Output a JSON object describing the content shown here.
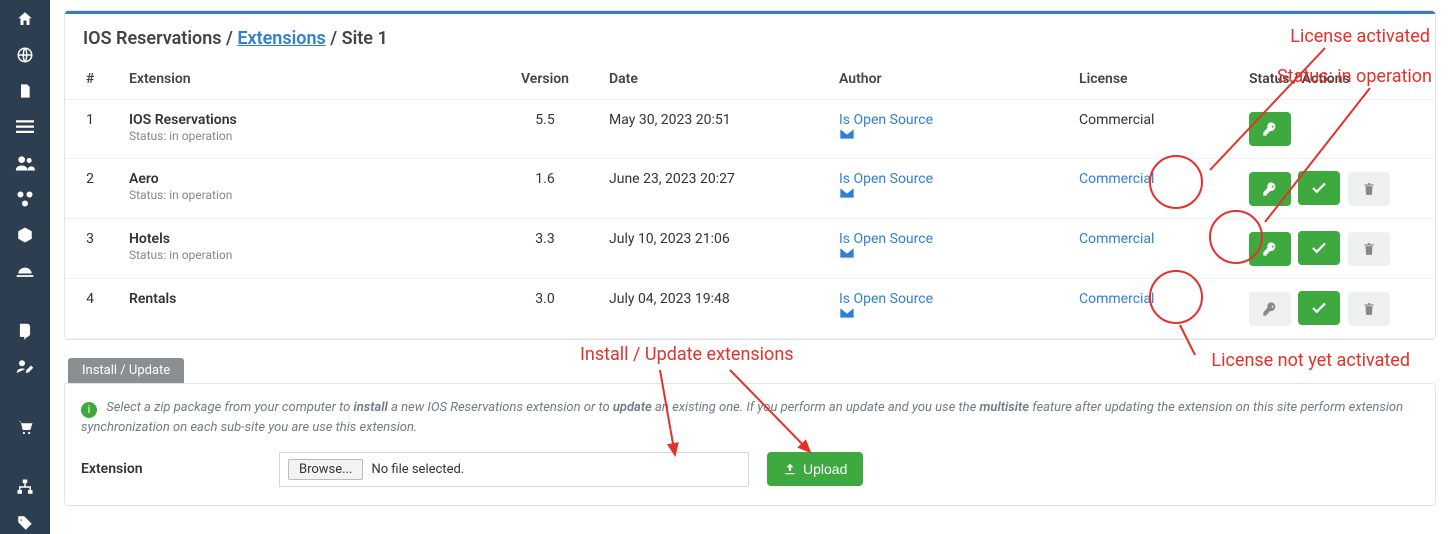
{
  "breadcrumb": {
    "part1": "IOS Reservations",
    "part2": "Extensions",
    "part3": "Site 1"
  },
  "headers": {
    "num": "#",
    "extension": "Extension",
    "version": "Version",
    "date": "Date",
    "author": "Author",
    "license": "License",
    "actions": "Status / Actions"
  },
  "rows": [
    {
      "num": "1",
      "name": "IOS Reservations",
      "status": "Status: in operation",
      "version": "5.5",
      "date": "May 30, 2023 20:51",
      "author": "Is Open Source",
      "license": "Commercial",
      "license_link": false,
      "key_active": true,
      "show_check": false,
      "show_trash": false
    },
    {
      "num": "2",
      "name": "Aero",
      "status": "Status: in operation",
      "version": "1.6",
      "date": "June 23, 2023 20:27",
      "author": "Is Open Source",
      "license": "Commercial",
      "license_link": true,
      "key_active": true,
      "show_check": true,
      "show_trash": true
    },
    {
      "num": "3",
      "name": "Hotels",
      "status": "Status: in operation",
      "version": "3.3",
      "date": "July 10, 2023 21:06",
      "author": "Is Open Source",
      "license": "Commercial",
      "license_link": true,
      "key_active": true,
      "show_check": true,
      "show_trash": true
    },
    {
      "num": "4",
      "name": "Rentals",
      "status": " ",
      "version": "3.0",
      "date": "July 04, 2023 19:48",
      "author": "Is Open Source",
      "license": "Commercial",
      "license_link": true,
      "key_active": false,
      "show_check": true,
      "show_trash": true
    }
  ],
  "install_panel": {
    "title": "Install / Update",
    "info_pre": "Select a zip package from your computer to ",
    "info_b1": "install",
    "info_mid": " a new IOS Reservations extension or to ",
    "info_b2": "update",
    "info_mid2": " an existing one. If you perform an update and you use the ",
    "info_b3": "multisite",
    "info_post": " feature after updating the extension on this site perform extension synchronization on each sub-site you are use this extension.",
    "ext_label": "Extension",
    "browse": "Browse...",
    "no_file": "No file selected.",
    "upload": "Upload"
  },
  "annotations": {
    "a1": "License activated",
    "a2": "Status: in operation",
    "a3": "Install / Update extensions",
    "a4": "License not yet activated"
  }
}
